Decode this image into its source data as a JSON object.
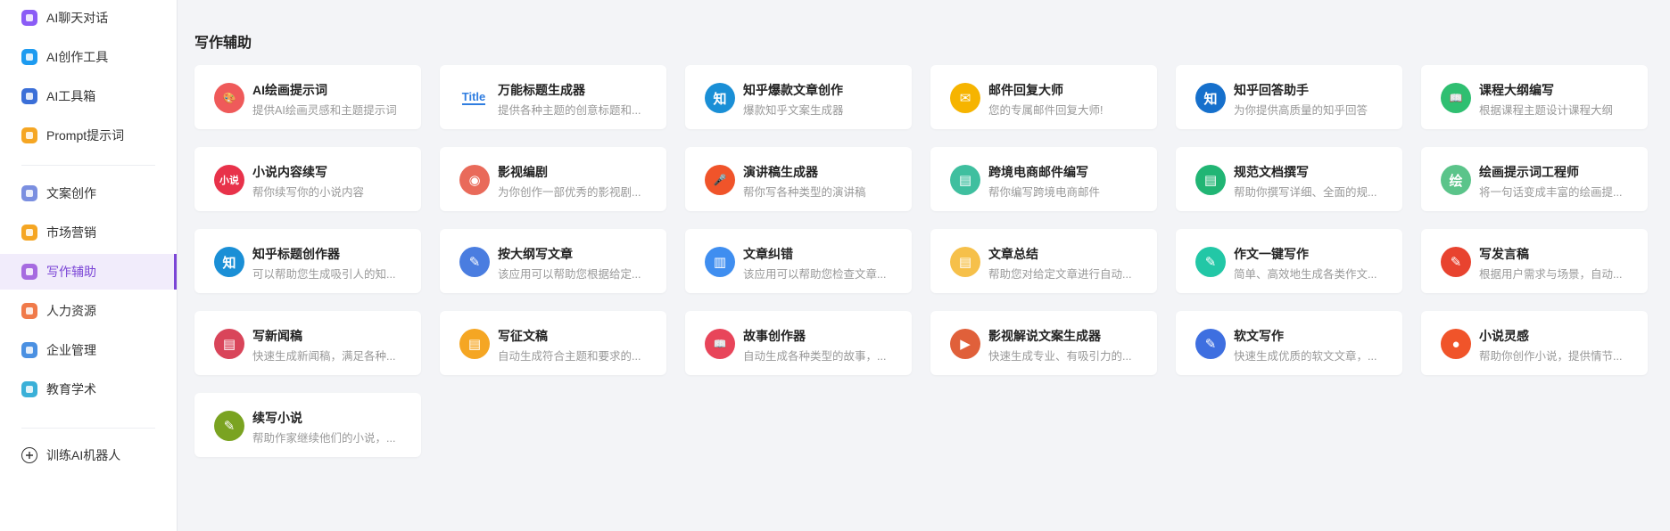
{
  "sidebar": {
    "items": [
      {
        "label": "AI聊天对话",
        "icon": "chat-bubble-icon",
        "color": "#8b5cf6"
      },
      {
        "label": "AI创作工具",
        "icon": "pen-icon",
        "color": "#1d9bf0"
      },
      {
        "label": "AI工具箱",
        "icon": "layers-icon",
        "color": "#3b6fd8"
      },
      {
        "label": "Prompt提示词",
        "icon": "prompt-icon",
        "color": "#f5a623"
      },
      {
        "label": "文案创作",
        "icon": "copywriting-icon",
        "color": "#7b8fe0"
      },
      {
        "label": "市场营销",
        "icon": "marketing-icon",
        "color": "#f5a623"
      },
      {
        "label": "写作辅助",
        "icon": "writing-assist-icon",
        "color": "#a66be0"
      },
      {
        "label": "人力资源",
        "icon": "hr-icon",
        "color": "#f07a4a"
      },
      {
        "label": "企业管理",
        "icon": "enterprise-icon",
        "color": "#4a90e2"
      },
      {
        "label": "教育学术",
        "icon": "education-icon",
        "color": "#3ab0d8"
      }
    ],
    "train_label": "训练AI机器人"
  },
  "main": {
    "section_title": "写作辅助",
    "cards": [
      {
        "title": "AI绘画提示词",
        "desc": "提供AI绘画灵感和主题提示词",
        "icon": "palette-icon",
        "color": "#ef5a5a",
        "glyph": "🎨"
      },
      {
        "title": "万能标题生成器",
        "desc": "提供各种主题的创意标题和...",
        "icon": "title-text-icon",
        "color": "#ffffff",
        "glyph": "Title"
      },
      {
        "title": "知乎爆款文章创作",
        "desc": "爆款知乎文案生成器",
        "icon": "zhihu-icon",
        "color": "#1a8fd6",
        "glyph": "知"
      },
      {
        "title": "邮件回复大师",
        "desc": "您的专属邮件回复大师!",
        "icon": "mail-icon",
        "color": "#f6b400",
        "glyph": "✉"
      },
      {
        "title": "知乎回答助手",
        "desc": "为你提供高质量的知乎回答",
        "icon": "zhihu-icon",
        "color": "#1670cc",
        "glyph": "知"
      },
      {
        "title": "课程大纲编写",
        "desc": "根据课程主题设计课程大纲",
        "icon": "book-icon",
        "color": "#2fbf71",
        "glyph": "📖"
      },
      {
        "title": "小说内容续写",
        "desc": "帮你续写你的小说内容",
        "icon": "novel-icon",
        "color": "#e8324a",
        "glyph": "小说"
      },
      {
        "title": "影视编剧",
        "desc": "为你创作一部优秀的影视剧...",
        "icon": "film-reel-icon",
        "color": "#e96a5a",
        "glyph": "◉"
      },
      {
        "title": "演讲稿生成器",
        "desc": "帮你写各种类型的演讲稿",
        "icon": "microphone-icon",
        "color": "#f0542a",
        "glyph": "🎤"
      },
      {
        "title": "跨境电商邮件编写",
        "desc": "帮你编写跨境电商邮件",
        "icon": "ecommerce-icon",
        "color": "#3fbf9f",
        "glyph": "▤"
      },
      {
        "title": "规范文档撰写",
        "desc": "帮助你撰写详细、全面的规...",
        "icon": "document-icon",
        "color": "#21b574",
        "glyph": "▤"
      },
      {
        "title": "绘画提示词工程师",
        "desc": "将一句话变成丰富的绘画提...",
        "icon": "paint-prompt-icon",
        "color": "#5bc48a",
        "glyph": "绘"
      },
      {
        "title": "知乎标题创作器",
        "desc": "可以帮助您生成吸引人的知...",
        "icon": "zhihu-icon",
        "color": "#1a8fd6",
        "glyph": "知"
      },
      {
        "title": "按大纲写文章",
        "desc": "该应用可以帮助您根据给定...",
        "icon": "notebook-pen-icon",
        "color": "#4a7de0",
        "glyph": "✎"
      },
      {
        "title": "文章纠错",
        "desc": "该应用可以帮助您检查文章...",
        "icon": "bar-chart-icon",
        "color": "#3f8ef0",
        "glyph": "▥"
      },
      {
        "title": "文章总结",
        "desc": "帮助您对给定文章进行自动...",
        "icon": "summary-icon",
        "color": "#f6c04a",
        "glyph": "▤"
      },
      {
        "title": "作文一键写作",
        "desc": "简单、高效地生成各类作文...",
        "icon": "pencil-icon",
        "color": "#22c7a6",
        "glyph": "✎"
      },
      {
        "title": "写发言稿",
        "desc": "根据用户需求与场景，自动...",
        "icon": "speech-draft-icon",
        "color": "#e8432f",
        "glyph": "✎"
      },
      {
        "title": "写新闻稿",
        "desc": "快速生成新闻稿，满足各种...",
        "icon": "news-icon",
        "color": "#d9455a",
        "glyph": "▤"
      },
      {
        "title": "写征文稿",
        "desc": "自动生成符合主题和要求的...",
        "icon": "essay-icon",
        "color": "#f5a623",
        "glyph": "▤"
      },
      {
        "title": "故事创作器",
        "desc": "自动生成各种类型的故事，...",
        "icon": "open-book-icon",
        "color": "#e8455a",
        "glyph": "📖"
      },
      {
        "title": "影视解说文案生成器",
        "desc": "快速生成专业、有吸引力的...",
        "icon": "video-commentary-icon",
        "color": "#e0603a",
        "glyph": "▶"
      },
      {
        "title": "软文写作",
        "desc": "快速生成优质的软文文章，...",
        "icon": "doc-edit-icon",
        "color": "#3e6fe0",
        "glyph": "✎"
      },
      {
        "title": "小说灵感",
        "desc": "帮助你创作小说，提供情节...",
        "icon": "inspiration-icon",
        "color": "#f0542a",
        "glyph": "●"
      },
      {
        "title": "续写小说",
        "desc": "帮助作家继续他们的小说，...",
        "icon": "continue-novel-icon",
        "color": "#7aa321",
        "glyph": "✎"
      }
    ]
  }
}
